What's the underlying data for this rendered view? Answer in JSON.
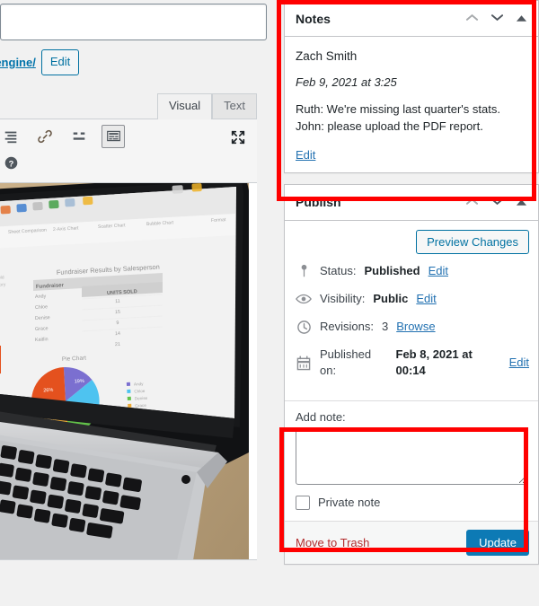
{
  "editor": {
    "title_value": "",
    "title_placeholder": "",
    "permalink_text": "-engine/",
    "permalink_edit_label": "Edit",
    "tabs": [
      {
        "label": "Visual",
        "active": true
      },
      {
        "label": "Text",
        "active": false
      }
    ],
    "toolbar": {
      "icons": [
        {
          "name": "align-justify-icon",
          "pressed": false
        },
        {
          "name": "insert-link-icon",
          "pressed": false
        },
        {
          "name": "insert-read-more-icon",
          "pressed": false
        },
        {
          "name": "toggle-toolbar-icon",
          "pressed": true
        },
        {
          "name": "help-icon",
          "pressed": false
        }
      ],
      "fullscreen_icon": "distraction-free-icon"
    },
    "media": {
      "alt": "Photo of a laptop screen showing a Numbers spreadsheet titled Fundraiser Results by Salesperson with a pie chart",
      "screen_doc_title": "Fundraiser Results by Salesperson",
      "screen_column_header": "UNITS SOLD",
      "screen_chart_title": "Pie Chart"
    }
  },
  "notes_panel": {
    "title": "Notes",
    "controls": [
      {
        "name": "move-up-icon",
        "glyph": "⌃"
      },
      {
        "name": "move-down-icon",
        "glyph": "⌄"
      },
      {
        "name": "toggle-panel-icon",
        "glyph": "▲"
      }
    ],
    "author": "Zach Smith",
    "date": "Feb 9, 2021 at 3:25",
    "lines": [
      "Ruth: We're missing last quarter's stats.",
      "John: please upload the PDF report."
    ],
    "edit_label": "Edit"
  },
  "publish_panel": {
    "title": "Publish",
    "controls": [
      {
        "name": "move-up-icon",
        "glyph": "⌃"
      },
      {
        "name": "move-down-icon",
        "glyph": "⌄"
      },
      {
        "name": "toggle-panel-icon",
        "glyph": "▲"
      }
    ],
    "preview_button": "Preview Changes",
    "rows": [
      {
        "icon": "pin-icon",
        "label": "Status:",
        "value": "Published",
        "action": "Edit"
      },
      {
        "icon": "eye-icon",
        "label": "Visibility:",
        "value": "Public",
        "action": "Edit"
      },
      {
        "icon": "clock-icon",
        "label": "Revisions:",
        "value": "3",
        "action": "Browse"
      },
      {
        "icon": "calendar-icon",
        "label": "Published on:",
        "value": "Feb 8, 2021 at 00:14",
        "action": "Edit"
      }
    ],
    "add_note": {
      "label": "Add note:",
      "textarea_value": "",
      "textarea_placeholder": "",
      "private_checkbox_label": "Private note",
      "private_checked": false
    },
    "trash_link": "Move to Trash",
    "update_button": "Update"
  },
  "colors": {
    "highlight": "#ff0000",
    "primary_button": "#0d7ab5",
    "link": "#2271b1",
    "trash_link": "#b32d2e"
  }
}
